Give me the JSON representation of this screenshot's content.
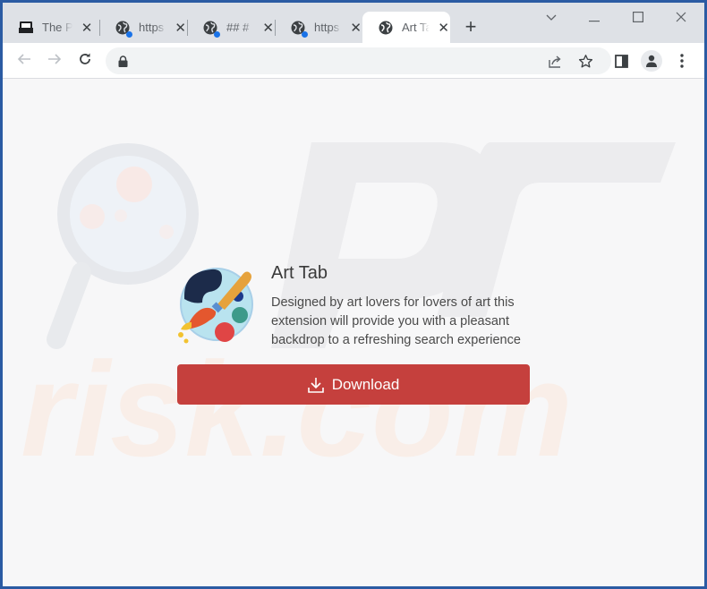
{
  "browser": {
    "tabs": [
      {
        "title": "The P",
        "favicon": "pc-monitor-icon",
        "active": false,
        "has_notification_dot": false
      },
      {
        "title": "https",
        "favicon": "globe-icon",
        "active": false,
        "has_notification_dot": true
      },
      {
        "title": "## #",
        "favicon": "globe-icon",
        "active": false,
        "has_notification_dot": true
      },
      {
        "title": "https",
        "favicon": "globe-icon",
        "active": false,
        "has_notification_dot": true
      },
      {
        "title": "Art Ta",
        "favicon": "globe-icon",
        "active": true,
        "has_notification_dot": false
      }
    ],
    "new_tab_label": "+",
    "close_glyph": "✕",
    "address": {
      "value": "",
      "placeholder": "",
      "secure_icon": "lock-icon"
    },
    "toolbar_icons": [
      "back-icon",
      "forward-icon",
      "reload-icon",
      "share-icon",
      "bookmark-star-icon",
      "side-panel-icon",
      "profile-icon",
      "menu-icon"
    ]
  },
  "page": {
    "extension": {
      "name": "Art Tab",
      "description": "Designed by art lovers for lovers of art this extension will provide you with a pleasant backdrop to a refreshing search experience",
      "icon": "paint-palette-brush-icon"
    },
    "download_button": {
      "label": "Download",
      "icon": "download-icon",
      "color": "#c5403d"
    },
    "watermark_text": "PC risk.com"
  },
  "colors": {
    "frame_border": "#2b5ba3",
    "tabstrip_bg": "#dee1e6",
    "page_bg": "#f7f7f8",
    "accent_dot": "#1a73e8"
  }
}
